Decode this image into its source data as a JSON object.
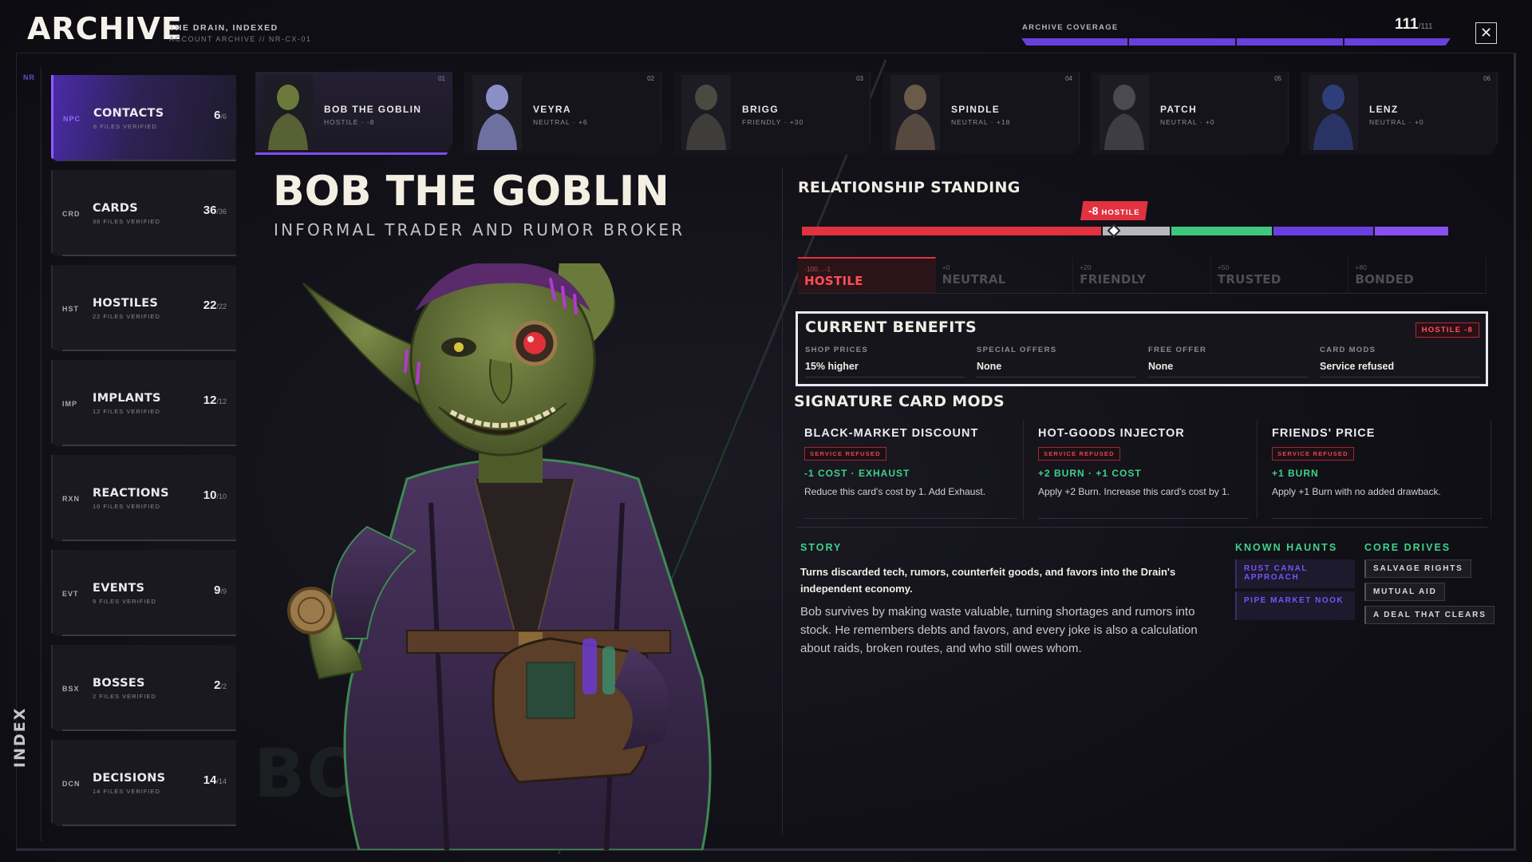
{
  "header": {
    "brand": "ARCHIVE",
    "subtitle": "THE DRAIN, INDEXED",
    "account": "ACCOUNT ARCHIVE // NR-CX-01",
    "coverage_label": "ARCHIVE COVERAGE",
    "coverage_count": "111",
    "coverage_total": "/111",
    "coverage_progress": 1.0,
    "close_icon": "close-icon"
  },
  "rail": {
    "top_code": "NR",
    "label": "INDEX"
  },
  "categories": [
    {
      "code": "NPC",
      "name": "CONTACTS",
      "meta": "6 FILES VERIFIED",
      "count": "6",
      "total": "/6",
      "active": true
    },
    {
      "code": "CRD",
      "name": "CARDS",
      "meta": "36 FILES VERIFIED",
      "count": "36",
      "total": "/36"
    },
    {
      "code": "HST",
      "name": "HOSTILES",
      "meta": "22 FILES VERIFIED",
      "count": "22",
      "total": "/22"
    },
    {
      "code": "IMP",
      "name": "IMPLANTS",
      "meta": "12 FILES VERIFIED",
      "count": "12",
      "total": "/12"
    },
    {
      "code": "RXN",
      "name": "REACTIONS",
      "meta": "10 FILES VERIFIED",
      "count": "10",
      "total": "/10"
    },
    {
      "code": "EVT",
      "name": "EVENTS",
      "meta": "9 FILES VERIFIED",
      "count": "9",
      "total": "/9"
    },
    {
      "code": "BSX",
      "name": "BOSSES",
      "meta": "2 FILES VERIFIED",
      "count": "2",
      "total": "/2"
    },
    {
      "code": "DCN",
      "name": "DECISIONS",
      "meta": "14 FILES VERIFIED",
      "count": "14",
      "total": "/14"
    }
  ],
  "contacts": [
    {
      "num": "01",
      "name": "BOB THE GOBLIN",
      "state": "HOSTILE · -8",
      "active": true,
      "color": "#6b7a3a"
    },
    {
      "num": "02",
      "name": "VEYRA",
      "state": "NEUTRAL · +6",
      "color": "#8a8fc8"
    },
    {
      "num": "03",
      "name": "BRIGG",
      "state": "FRIENDLY · +30",
      "color": "#4a4a40"
    },
    {
      "num": "04",
      "name": "SPINDLE",
      "state": "NEUTRAL · +18",
      "color": "#6a5a48"
    },
    {
      "num": "05",
      "name": "PATCH",
      "state": "NEUTRAL · +0",
      "color": "#4a4a52"
    },
    {
      "num": "06",
      "name": "LENZ",
      "state": "NEUTRAL · +0",
      "color": "#2e3e7a"
    }
  ],
  "hero": {
    "name": "BOB THE GOBLIN",
    "role": "INFORMAL TRADER AND RUMOR BROKER",
    "ghost": "BO"
  },
  "standing": {
    "heading": "RELATIONSHIP STANDING",
    "value": "-8",
    "value_label": "HOSTILE",
    "score": -8,
    "tiers": [
      {
        "range": "-100…-1",
        "label": "HOSTILE",
        "active": true,
        "color": "#e0323f"
      },
      {
        "range": "+0",
        "label": "NEUTRAL",
        "color": "#b9b7bd"
      },
      {
        "range": "+20",
        "label": "FRIENDLY",
        "color": "#3fc77e"
      },
      {
        "range": "+50",
        "label": "TRUSTED",
        "color": "#6a3fe0"
      },
      {
        "range": "+80",
        "label": "BONDED",
        "color": "#8a4ff0"
      }
    ]
  },
  "benefits": {
    "heading": "CURRENT BENEFITS",
    "tag": "HOSTILE -8",
    "items": [
      {
        "key": "SHOP PRICES",
        "value": "15% higher"
      },
      {
        "key": "SPECIAL OFFERS",
        "value": "None"
      },
      {
        "key": "FREE OFFER",
        "value": "None"
      },
      {
        "key": "CARD MODS",
        "value": "Service refused"
      }
    ]
  },
  "mods": {
    "heading": "SIGNATURE CARD MODS",
    "items": [
      {
        "name": "BLACK-MARKET DISCOUNT",
        "status": "SERVICE REFUSED",
        "effect": "-1 COST · EXHAUST",
        "desc": "Reduce this card's cost by 1. Add Exhaust."
      },
      {
        "name": "HOT-GOODS INJECTOR",
        "status": "SERVICE REFUSED",
        "effect": "+2 BURN · +1 COST",
        "desc": "Apply +2 Burn. Increase this card's cost by 1."
      },
      {
        "name": "FRIENDS' PRICE",
        "status": "SERVICE REFUSED",
        "effect": "+1 BURN",
        "desc": "Apply +1 Burn with no added drawback."
      }
    ]
  },
  "story": {
    "heading": "STORY",
    "lead": "Turns discarded tech, rumors, counterfeit goods, and favors into the Drain's independent economy.",
    "body": "Bob survives by making waste valuable, turning shortages and rumors into stock. He remembers debts and favors, and every joke is also a calculation about raids, broken routes, and who still owes whom."
  },
  "haunts": {
    "heading": "KNOWN HAUNTS",
    "items": [
      "RUST CANAL APPROACH",
      "PIPE MARKET NOOK"
    ]
  },
  "drives": {
    "heading": "CORE DRIVES",
    "items": [
      "SALVAGE RIGHTS",
      "MUTUAL AID",
      "A DEAL THAT CLEARS"
    ]
  },
  "colors": {
    "accent": "#7a4ef2",
    "hostile": "#e0323f",
    "friendly": "#3fd28a",
    "panel": "#16151c"
  }
}
